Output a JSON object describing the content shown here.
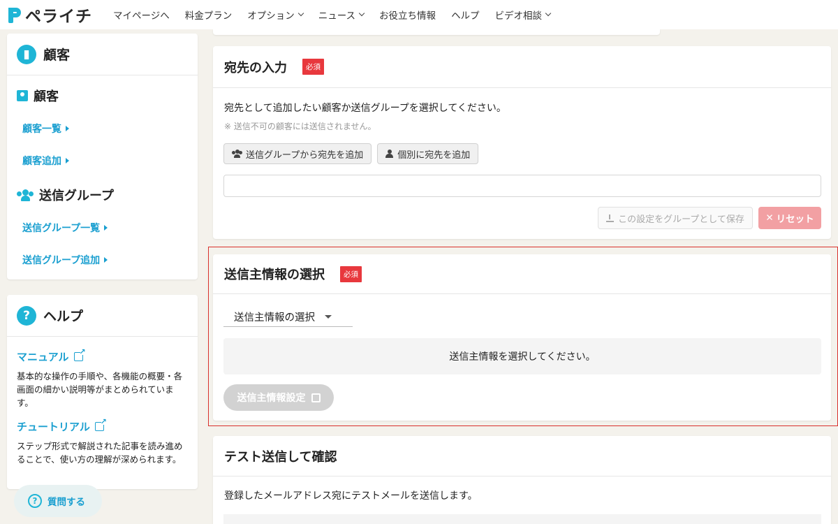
{
  "nav": {
    "logo": "ペライチ",
    "items": [
      {
        "label": "マイページへ",
        "dropdown": false
      },
      {
        "label": "料金プラン",
        "dropdown": false
      },
      {
        "label": "オプション",
        "dropdown": true
      },
      {
        "label": "ニュース",
        "dropdown": true
      },
      {
        "label": "お役立ち情報",
        "dropdown": false
      },
      {
        "label": "ヘルプ",
        "dropdown": false
      },
      {
        "label": "ビデオ相談",
        "dropdown": true
      }
    ]
  },
  "sidebar": {
    "customer_card_title": "顧客",
    "customer_section_title": "顧客",
    "customer_links": [
      "顧客一覧",
      "顧客追加"
    ],
    "group_section_title": "送信グループ",
    "group_links": [
      "送信グループ一覧",
      "送信グループ追加"
    ],
    "help_card_title": "ヘルプ",
    "help_items": [
      {
        "title": "マニュアル",
        "desc": "基本的な操作の手順や、各機能の概要・各画面の細かい説明等がまとめられています。"
      },
      {
        "title": "チュートリアル",
        "desc": "ステップ形式で解説された記事を読み進めることで、使い方の理解が深められます。"
      }
    ],
    "ask_button": "質問する"
  },
  "recipient": {
    "title": "宛先の入力",
    "badge": "必須",
    "instruction": "宛先として追加したい顧客か送信グループを選択してください。",
    "note": "※ 送信不可の顧客には送信されません。",
    "add_from_group_button": "送信グループから宛先を追加",
    "add_individual_button": "個別に宛先を追加",
    "input_value": "",
    "save_group_button": "この設定をグループとして保存",
    "reset_button": "リセット"
  },
  "sender": {
    "title": "送信主情報の選択",
    "badge": "必須",
    "select_label": "送信主情報の選択",
    "info_message": "送信主情報を選択してください。",
    "settings_button": "送信主情報設定"
  },
  "test_send": {
    "title": "テスト送信して確認",
    "description": "登録したメールアドレス宛にテストメールを送信します。"
  },
  "colors": {
    "accent": "#1fb5d6",
    "link": "#1a9fd0",
    "required_badge": "#e8383d",
    "highlight_border": "#d9302c"
  }
}
